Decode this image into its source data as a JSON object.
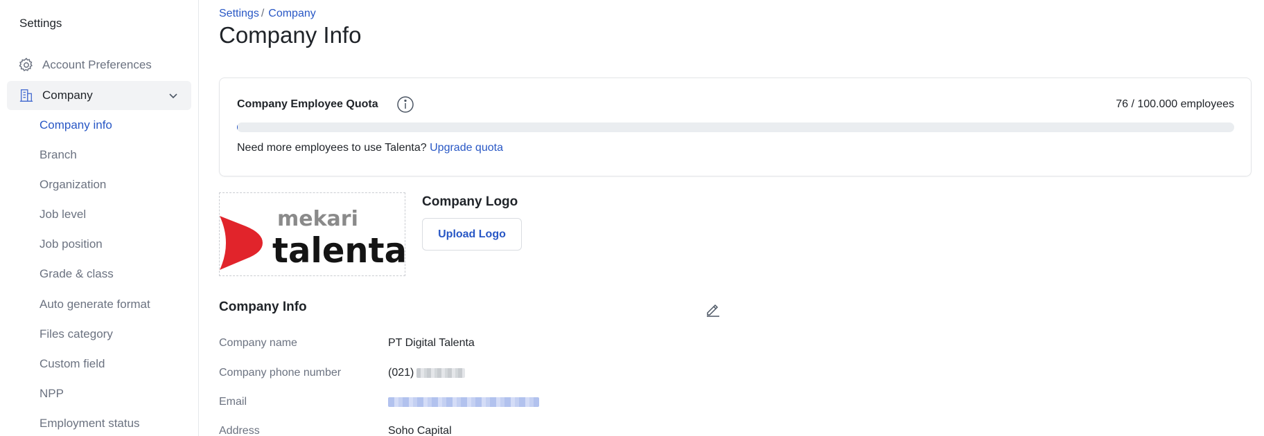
{
  "sidebar": {
    "title": "Settings",
    "items": [
      {
        "label": "Account Preferences",
        "icon": "gear-icon"
      },
      {
        "label": "Company",
        "icon": "building-icon",
        "expanded": true
      }
    ],
    "sub_items": [
      {
        "label": "Company info",
        "active": true
      },
      {
        "label": "Branch"
      },
      {
        "label": "Organization"
      },
      {
        "label": "Job level"
      },
      {
        "label": "Job position"
      },
      {
        "label": "Grade & class"
      },
      {
        "label": "Auto generate format"
      },
      {
        "label": "Files category"
      },
      {
        "label": "Custom field"
      },
      {
        "label": "NPP"
      },
      {
        "label": "Employment status"
      }
    ]
  },
  "breadcrumb": {
    "items": [
      "Settings",
      "Company"
    ],
    "separator": "/"
  },
  "page_title": "Company Info",
  "quota": {
    "title": "Company Employee Quota",
    "count_text": "76 / 100.000 employees",
    "used": 76,
    "total": 100000,
    "fill_fraction": 0.00076,
    "message": "Need more employees to use Talenta?",
    "link": "Upgrade quota"
  },
  "logo": {
    "heading": "Company Logo",
    "upload_label": "Upload Logo",
    "brand_small": "mekari",
    "brand_large": "talenta"
  },
  "company_info": {
    "heading": "Company Info",
    "rows": [
      {
        "key": "Company name",
        "value": "PT Digital Talenta"
      },
      {
        "key": "Company phone number",
        "value": "(021)"
      },
      {
        "key": "Email",
        "value": ""
      },
      {
        "key": "Address",
        "value": "Soho Capital"
      }
    ]
  },
  "colors": {
    "accent": "#2857c5",
    "brand_red": "#e1242b",
    "muted_text": "#6b7280",
    "active_row_bg": "#f2f3f5"
  }
}
